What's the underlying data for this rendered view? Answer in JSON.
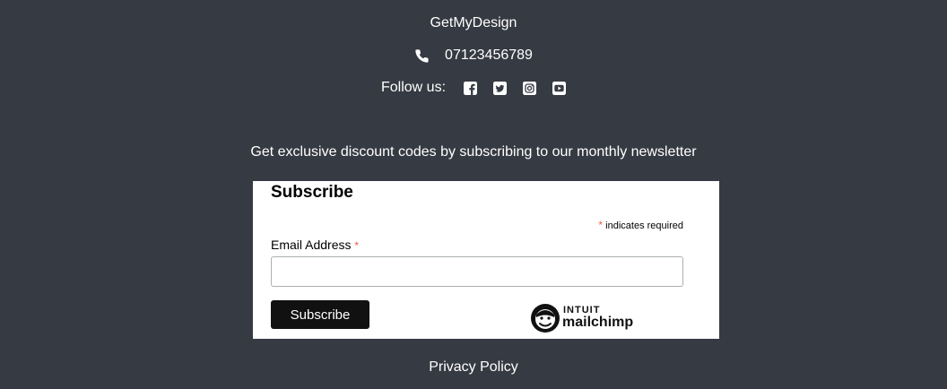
{
  "colors": {
    "background": "#363a42",
    "text": "#ffffff",
    "card": "#ffffff",
    "required_star": "#e85c41",
    "button": "#111111"
  },
  "footer": {
    "brand": "GetMyDesign",
    "phone": {
      "icon": "phone-icon",
      "number": "07123456789"
    },
    "follow_label": "Follow us:",
    "social": [
      {
        "name": "facebook",
        "icon": "facebook-icon"
      },
      {
        "name": "twitter",
        "icon": "twitter-icon"
      },
      {
        "name": "instagram",
        "icon": "instagram-icon"
      },
      {
        "name": "youtube",
        "icon": "youtube-icon"
      }
    ],
    "newsletter_tagline": "Get exclusive discount codes by subscribing to our monthly newsletter",
    "privacy_link": "Privacy Policy"
  },
  "subscribe_form": {
    "title": "Subscribe",
    "required_star": "*",
    "required_note": "indicates required",
    "email_label": "Email Address",
    "email_value": "",
    "email_placeholder": "",
    "submit_label": "Subscribe",
    "badge": {
      "intuit": "INTUIT",
      "mailchimp": "mailchimp",
      "icon": "mailchimp-freddie-icon"
    }
  }
}
